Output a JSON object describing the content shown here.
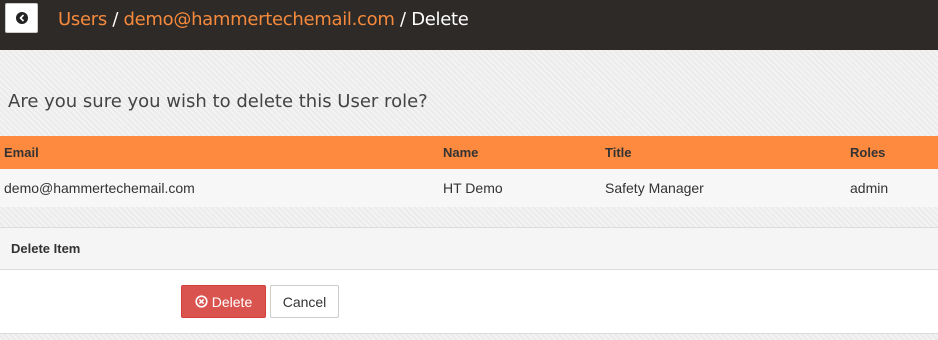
{
  "header": {
    "back_icon": "arrow-left-circle-icon",
    "breadcrumb": {
      "users": "Users",
      "sep1": " / ",
      "email": "demo@hammertechemail.com",
      "sep2": " / ",
      "current": "Delete"
    }
  },
  "main": {
    "question": "Are you sure you wish to delete this User role?"
  },
  "table": {
    "columns": {
      "email": "Email",
      "name": "Name",
      "title": "Title",
      "roles": "Roles"
    },
    "rows": [
      {
        "email": "demo@hammertechemail.com",
        "name": "HT Demo",
        "title": "Safety Manager",
        "roles": "admin"
      }
    ]
  },
  "panel": {
    "heading": "Delete Item",
    "delete_label": "Delete",
    "delete_icon": "times-circle-icon",
    "cancel_label": "Cancel"
  },
  "colors": {
    "topbar": "#2e2a28",
    "accent": "#f58a3c",
    "table_header": "#fd8a3f",
    "danger": "#d9534f"
  }
}
